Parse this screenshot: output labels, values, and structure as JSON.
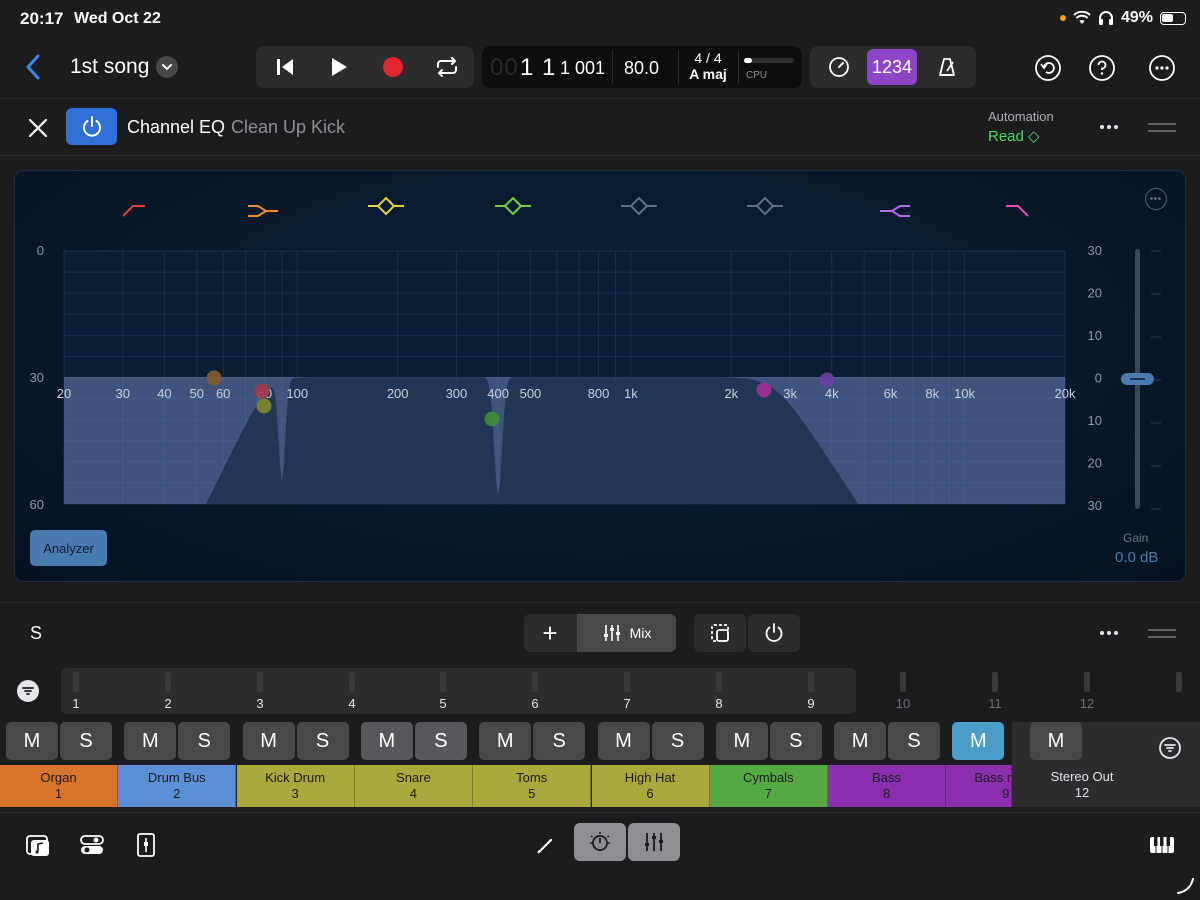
{
  "status_bar": {
    "time": "20:17",
    "date": "Wed Oct 22",
    "battery": "49%"
  },
  "toolbar": {
    "song_title": "1st song",
    "lcd": {
      "position_faint": "00",
      "position": "1 1",
      "position_sub": "1 001",
      "tempo": "80.0",
      "time_signature": "4 / 4",
      "key": "A maj",
      "cpu_label": "CPU"
    },
    "count_in_label": "1234"
  },
  "plugin": {
    "name": "Channel EQ",
    "preset": "Clean Up Kick",
    "automation_label": "Automation",
    "automation_mode": "Read ◇"
  },
  "eq": {
    "db_left_labels": [
      "0",
      "30",
      "60"
    ],
    "db_right_labels": [
      "30",
      "20",
      "10",
      "0",
      "10",
      "20",
      "30"
    ],
    "freq_labels": [
      "20",
      "30",
      "40",
      "50",
      "60",
      "80",
      "100",
      "200",
      "300",
      "400",
      "500",
      "800",
      "1k",
      "2k",
      "3k",
      "4k",
      "6k",
      "8k",
      "10k",
      "20k"
    ],
    "band_colors": [
      "#e0453a",
      "#f08a2b",
      "#e6d23a",
      "#6fd13d",
      "#5f7186",
      "#5f7186",
      "#b36ae6",
      "#e64fb3"
    ],
    "band_icons": [
      "low-cut-icon",
      "low-shelf-icon",
      "bell-icon",
      "bell-icon",
      "bell-icon",
      "bell-icon",
      "high-shelf-icon",
      "high-cut-icon"
    ],
    "analyzer_label": "Analyzer",
    "gain_label": "Gain",
    "gain_value": "0.0 dB"
  },
  "mixer": {
    "s_label": "S",
    "mix_label": "Mix",
    "track_numbers": [
      "1",
      "2",
      "3",
      "4",
      "5",
      "6",
      "7",
      "8",
      "9",
      "10",
      "11",
      "12"
    ],
    "mute_label": "M",
    "solo_label": "S",
    "channels": [
      {
        "name": "Organ",
        "number": "1",
        "color": "#d9742d"
      },
      {
        "name": "Drum Bus",
        "number": "2",
        "color": "#5d8fd6"
      },
      {
        "name": "Kick Drum",
        "number": "3",
        "color": "#a9a83a"
      },
      {
        "name": "Snare",
        "number": "4",
        "color": "#a9a83a"
      },
      {
        "name": "Toms",
        "number": "5",
        "color": "#a9a83a"
      },
      {
        "name": "High Hat",
        "number": "6",
        "color": "#a9a83a"
      },
      {
        "name": "Cymbals",
        "number": "7",
        "color": "#54a943"
      },
      {
        "name": "Bass",
        "number": "8",
        "color": "#8a2fb0"
      },
      {
        "name": "Bass r",
        "number": "9",
        "color": "#8a2fb0"
      }
    ],
    "stereo_out": {
      "name": "Stereo Out",
      "number": "12"
    }
  }
}
